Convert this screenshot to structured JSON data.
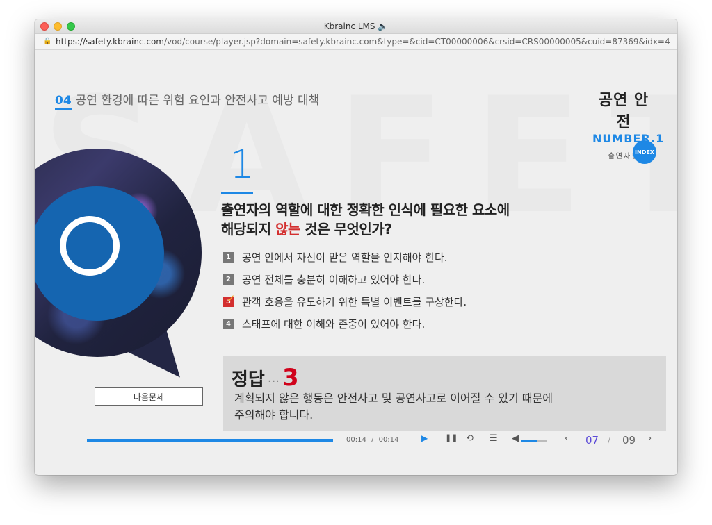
{
  "window": {
    "title": "Kbrainc LMS 🔈",
    "url_host": "https://safety.kbrainc.com",
    "url_path": "/vod/course/player.jsp?domain=safety.kbrainc.com&type=&cid=CT00000006&crsid=CRS00000005&cuid=87369&idx=4"
  },
  "header": {
    "chapter_num": "04",
    "chapter_title": "공연 환경에 따른 위험 요인과 안전사고 예방 대책",
    "brand_title": "공연 안전",
    "brand_number": "NUMBER.1",
    "brand_sub": "출연자편",
    "index_label": "INDEX"
  },
  "quiz": {
    "number": "1",
    "question_line1": "출연자의 역할에 대한 정확한 인식에 필요한 요소에",
    "question_line2_pre": "해당되지 ",
    "question_line2_red": "않는",
    "question_line2_post": " 것은 무엇인가?",
    "options": [
      {
        "no": "1",
        "text": "공연 안에서 자신이 맡은 역할을 인지해야 한다.",
        "selected": false
      },
      {
        "no": "2",
        "text": "공연 전체를 충분히 이해하고 있어야 한다.",
        "selected": false
      },
      {
        "no": "3",
        "text": "관객 호응을 유도하기 위한 특별 이벤트를 구상한다.",
        "selected": true
      },
      {
        "no": "4",
        "text": "스태프에 대한 이해와 존중이 있어야 한다.",
        "selected": false
      }
    ],
    "answer_label": "정답",
    "answer_dots": "···",
    "answer_number": "3",
    "explanation_line1": "계획되지 않은 행동은 안전사고 및 공연사고로 이어질 수 있기 때문에",
    "explanation_line2": "주의해야 합니다.",
    "next_button": "다음문제"
  },
  "player": {
    "current_time": "00:14",
    "time_sep": "/",
    "total_time": "00:14",
    "progress": 1.0,
    "volume": 0.6,
    "page_current": "07",
    "page_sep": "/",
    "page_total": "09",
    "accent_color": "#1e88e5"
  }
}
